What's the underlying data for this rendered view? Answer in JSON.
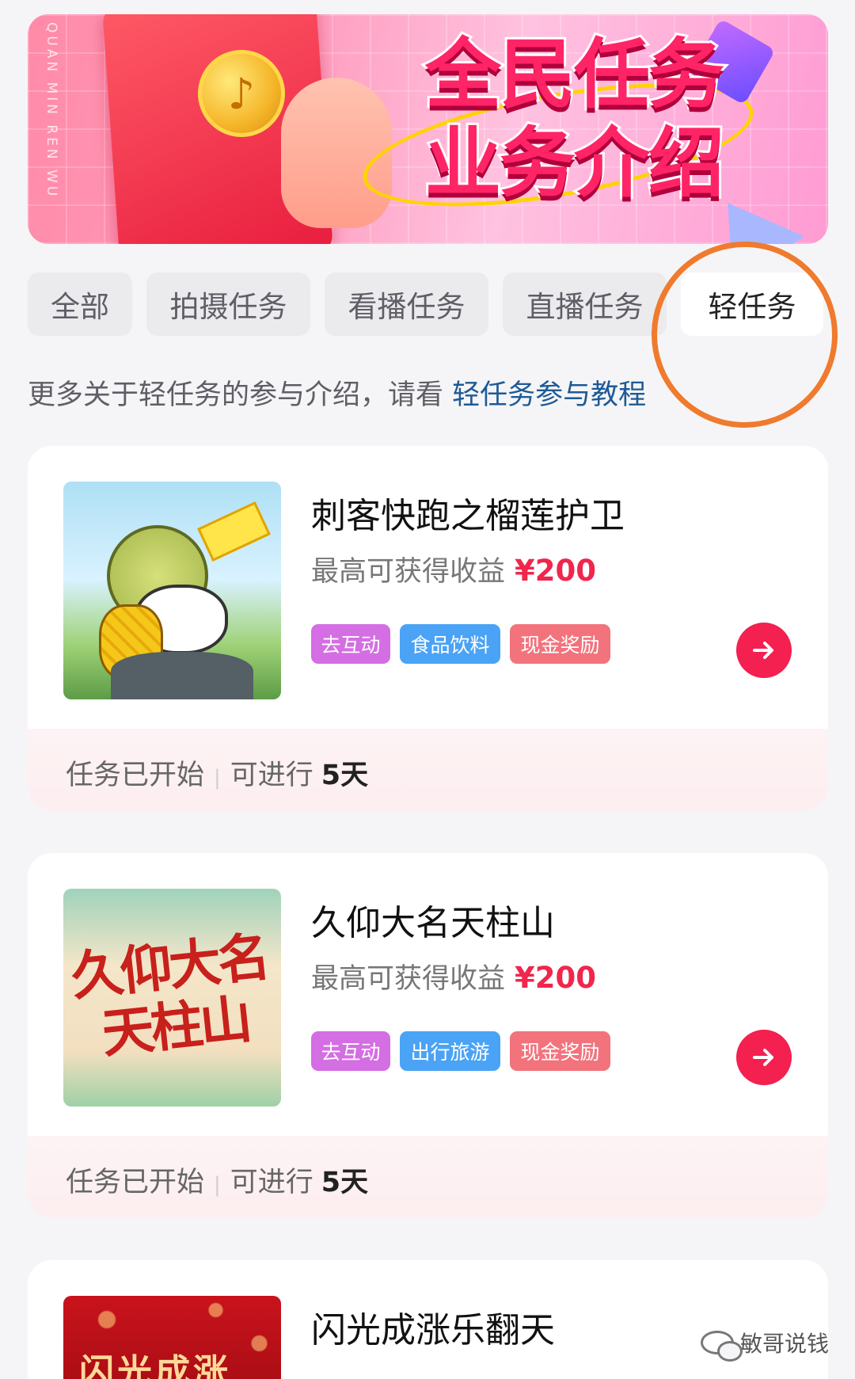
{
  "banner": {
    "title_line1": "全民任务",
    "title_line2": "业务介绍",
    "side_text": "QUAN MIN REN WU"
  },
  "tabs": [
    {
      "label": "全部",
      "active": false
    },
    {
      "label": "拍摄任务",
      "active": false
    },
    {
      "label": "看播任务",
      "active": false
    },
    {
      "label": "直播任务",
      "active": false
    },
    {
      "label": "轻任务",
      "active": true
    }
  ],
  "hint": {
    "text": "更多关于轻任务的参与介绍，请看",
    "link": "轻任务参与教程"
  },
  "tasks": [
    {
      "name": "刺客快跑之榴莲护卫",
      "reward_label": "最高可获得收益",
      "reward_amount": "¥200",
      "tags": [
        "去互动",
        "食品饮料",
        "现金奖励"
      ],
      "status": "任务已开始",
      "remaining_label": "可进行",
      "remaining_days": "5天"
    },
    {
      "name": "久仰大名天柱山",
      "thumb_text": "久仰大名天柱山",
      "reward_label": "最高可获得收益",
      "reward_amount": "¥200",
      "tags": [
        "去互动",
        "出行旅游",
        "现金奖励"
      ],
      "status": "任务已开始",
      "remaining_label": "可进行",
      "remaining_days": "5天"
    },
    {
      "name": "闪光成涨乐翻天",
      "thumb_text": "闪光成涨"
    }
  ],
  "watermark": "敏哥说钱",
  "colors": {
    "accent": "#f32050",
    "link": "#1e5a96",
    "annotation": "#f07a2d",
    "tag_purple": "#d46ee3",
    "tag_blue": "#4aa3f5",
    "tag_red": "#f2737c"
  }
}
